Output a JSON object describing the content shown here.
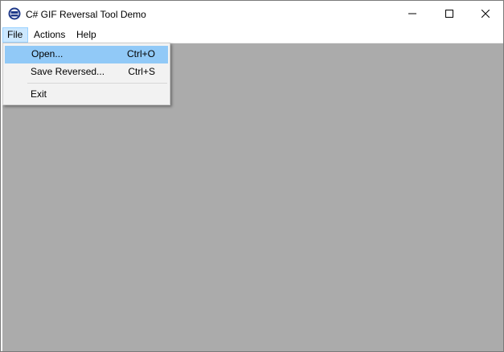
{
  "window": {
    "title": "C# GIF Reversal Tool Demo",
    "icon": "app-badge-icon"
  },
  "caption_buttons": {
    "minimize_icon": "minimize-icon",
    "maximize_icon": "maximize-icon",
    "close_icon": "close-icon"
  },
  "menubar": {
    "items": [
      {
        "label": "File",
        "active": true
      },
      {
        "label": "Actions"
      },
      {
        "label": "Help"
      }
    ]
  },
  "file_menu": {
    "items": [
      {
        "label": "Open...",
        "shortcut": "Ctrl+O",
        "highlighted": true
      },
      {
        "label": "Save Reversed...",
        "shortcut": "Ctrl+S"
      },
      {
        "label": "Exit"
      }
    ]
  },
  "colors": {
    "client_background": "#ababab",
    "menu_highlight": "#91c9f7",
    "menubar_active": "#cce8ff"
  }
}
